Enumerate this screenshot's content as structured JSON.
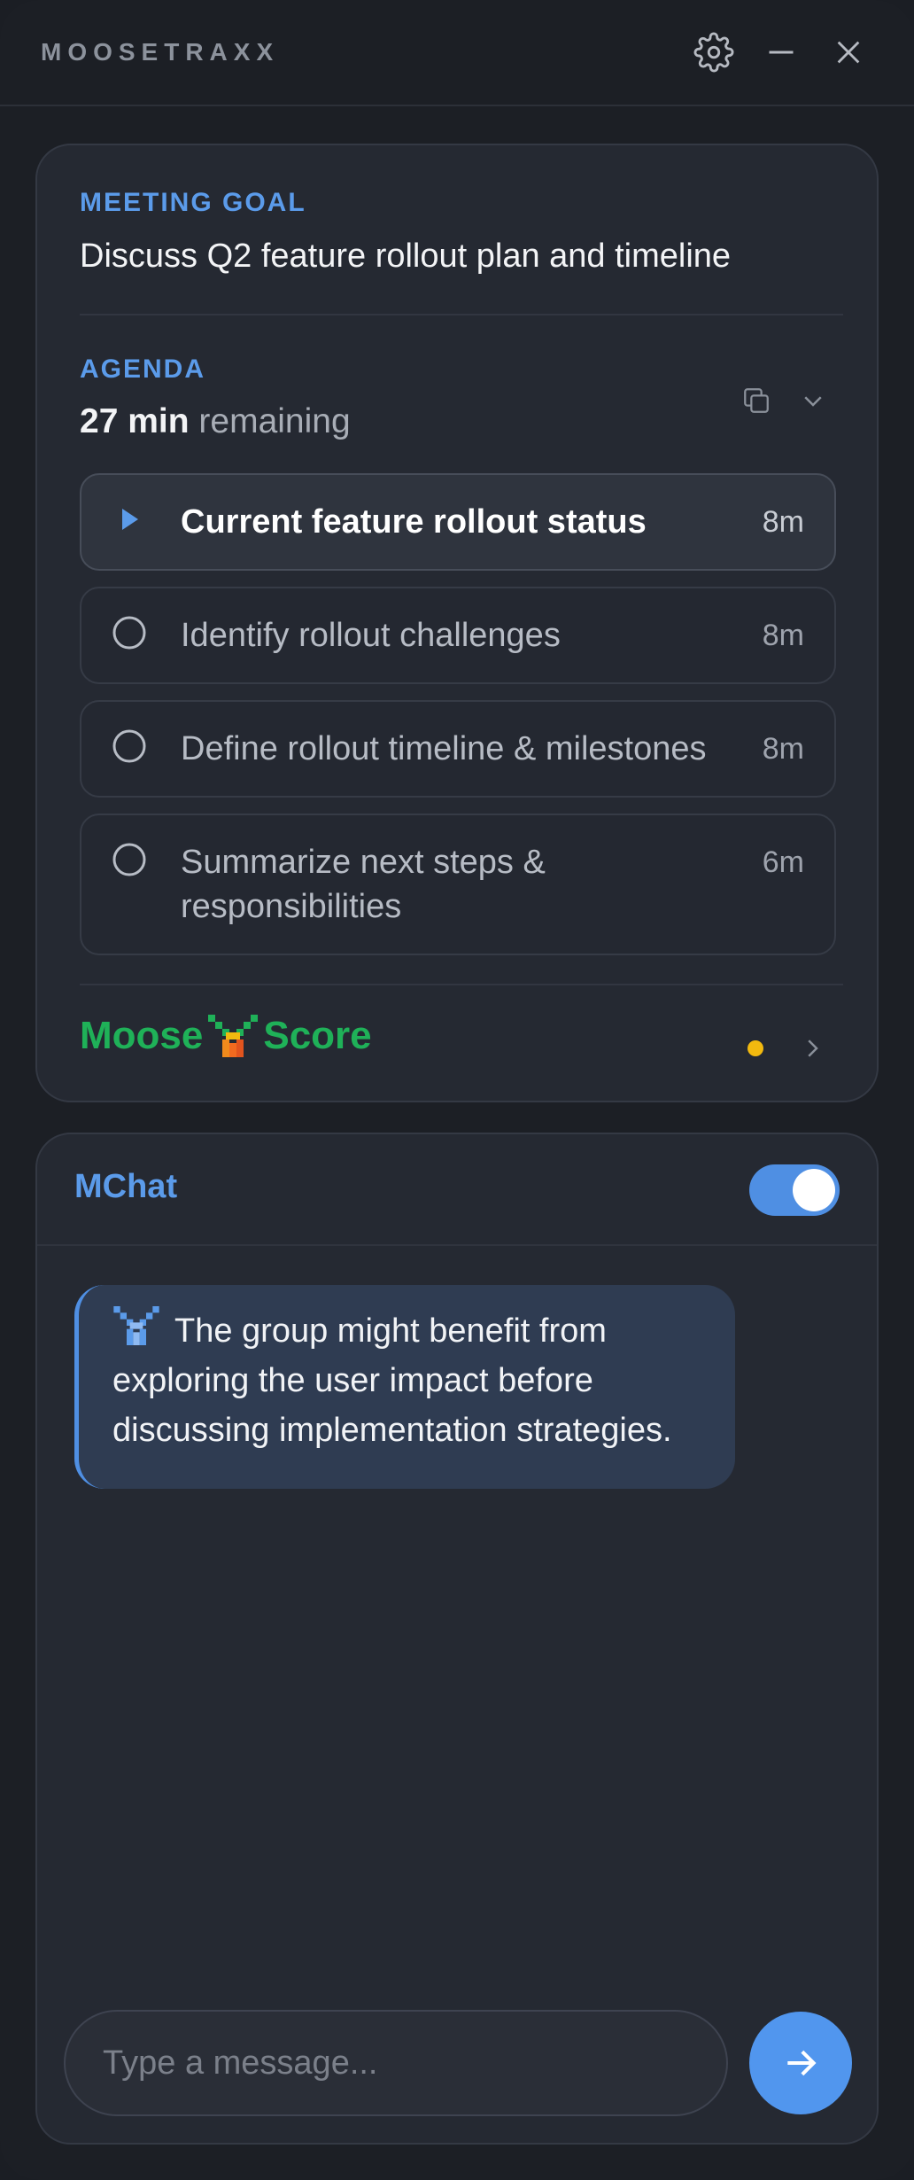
{
  "app": {
    "title": "MOOSETRAXX"
  },
  "titlebar": {
    "icons": [
      "gear-icon",
      "minimize-icon",
      "close-icon"
    ]
  },
  "meeting": {
    "goal_label": "MEETING GOAL",
    "goal_text": "Discuss Q2 feature rollout plan and timeline"
  },
  "agenda": {
    "label": "AGENDA",
    "remaining_value": "27 min",
    "remaining_suffix": " remaining",
    "items": [
      {
        "text": "Current feature rollout status",
        "duration": "8m",
        "state": "active"
      },
      {
        "text": "Identify rollout challenges",
        "duration": "8m",
        "state": "pending"
      },
      {
        "text": "Define rollout timeline & milestones",
        "duration": "8m",
        "state": "pending"
      },
      {
        "text": "Summarize next steps & responsibilities",
        "duration": "6m",
        "state": "pending"
      }
    ]
  },
  "moosescore": {
    "left": "Moose",
    "right": "Score",
    "indicator_color": "#f2b90f"
  },
  "chat": {
    "title": "MChat",
    "toggle_on": true,
    "messages": [
      {
        "text": "The group might benefit from exploring the user impact before discussing implementation strategies."
      }
    ],
    "input_placeholder": "Type a message..."
  },
  "colors": {
    "accent": "#5b9bea",
    "score_green": "#1fb158",
    "background": "#1c1f25"
  }
}
